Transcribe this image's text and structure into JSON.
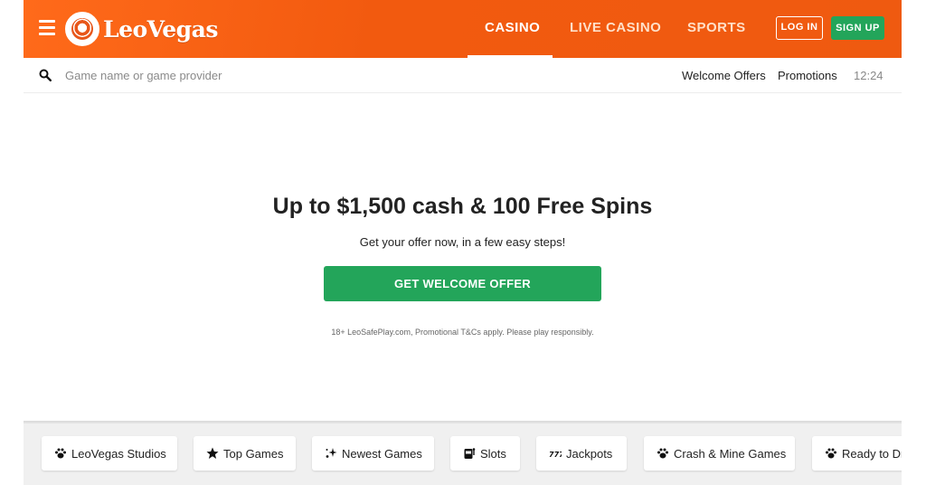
{
  "header": {
    "brand": "LeoVegas",
    "tabs": [
      {
        "label": "CASINO",
        "active": true
      },
      {
        "label": "LIVE CASINO",
        "active": false
      },
      {
        "label": "SPORTS",
        "active": false
      }
    ],
    "login_label": "LOG IN",
    "signup_label": "SIGN UP"
  },
  "search": {
    "placeholder": "Game name or game provider",
    "links": [
      "Welcome Offers",
      "Promotions"
    ],
    "time": "12:24"
  },
  "hero": {
    "title": "Up to $1,500 cash & 100 Free Spins",
    "subtitle": "Get your offer now, in a few easy steps!",
    "cta_label": "GET WELCOME OFFER",
    "disclaimer": "18+ LeoSafePlay.com, Promotional T&Cs apply. Please play responsibly."
  },
  "categories": [
    {
      "label": "LeoVegas Studios",
      "icon": "paw-icon"
    },
    {
      "label": "Top Games",
      "icon": "star-icon"
    },
    {
      "label": "Newest Games",
      "icon": "sparkle-icon"
    },
    {
      "label": "Slots",
      "icon": "slot-machine-icon"
    },
    {
      "label": "Jackpots",
      "icon": "seven-icon"
    },
    {
      "label": "Crash & Mine Games",
      "icon": "paw-icon"
    },
    {
      "label": "Ready to Dr",
      "icon": "paw-icon"
    }
  ],
  "colors": {
    "brand_orange": "#f25a0f",
    "accent_green": "#23a55a"
  }
}
